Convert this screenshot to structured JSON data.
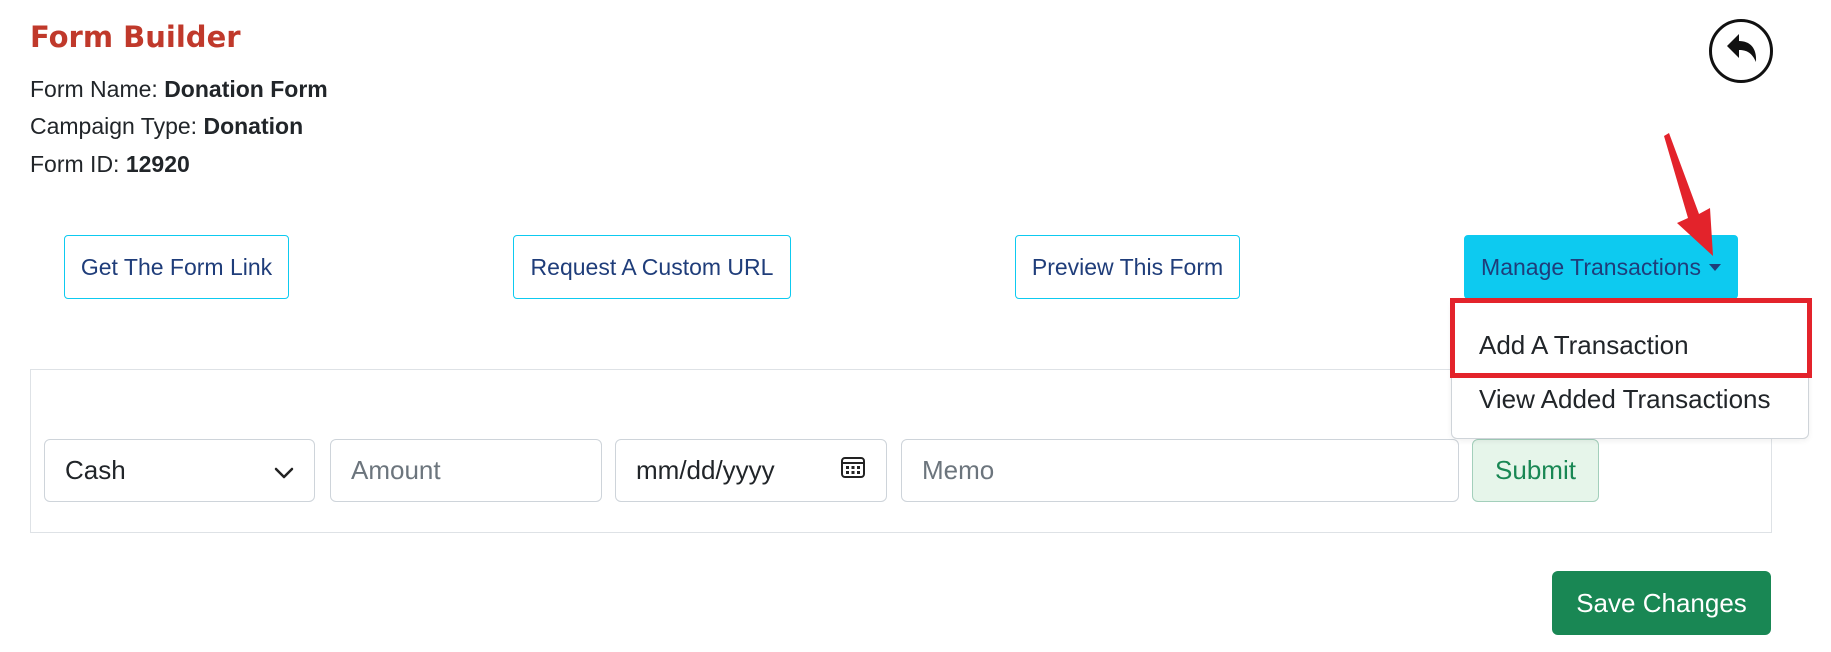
{
  "header": {
    "title": "Form Builder",
    "form_name_label": "Form Name:",
    "form_name_value": "Donation Form",
    "campaign_type_label": "Campaign Type:",
    "campaign_type_value": "Donation",
    "form_id_label": "Form ID:",
    "form_id_value": "12920",
    "back_icon": "undo-arrow-icon"
  },
  "actions": {
    "get_link": "Get The Form Link",
    "custom_url": "Request A Custom URL",
    "preview": "Preview This Form",
    "manage": "Manage Transactions"
  },
  "dropdown": {
    "items": [
      "Add A Transaction",
      "View Added Transactions"
    ],
    "highlighted": "Add A Transaction"
  },
  "transaction_form": {
    "payment_type_selected": "Cash",
    "amount_placeholder": "Amount",
    "date_placeholder": "mm/dd/yyyy",
    "memo_placeholder": "Memo",
    "submit_label": "Submit"
  },
  "footer": {
    "save_label": "Save Changes"
  },
  "colors": {
    "title": "#c0392b",
    "info_button": "#0dcaf0",
    "success": "#198754",
    "annotation": "#e3232b"
  }
}
